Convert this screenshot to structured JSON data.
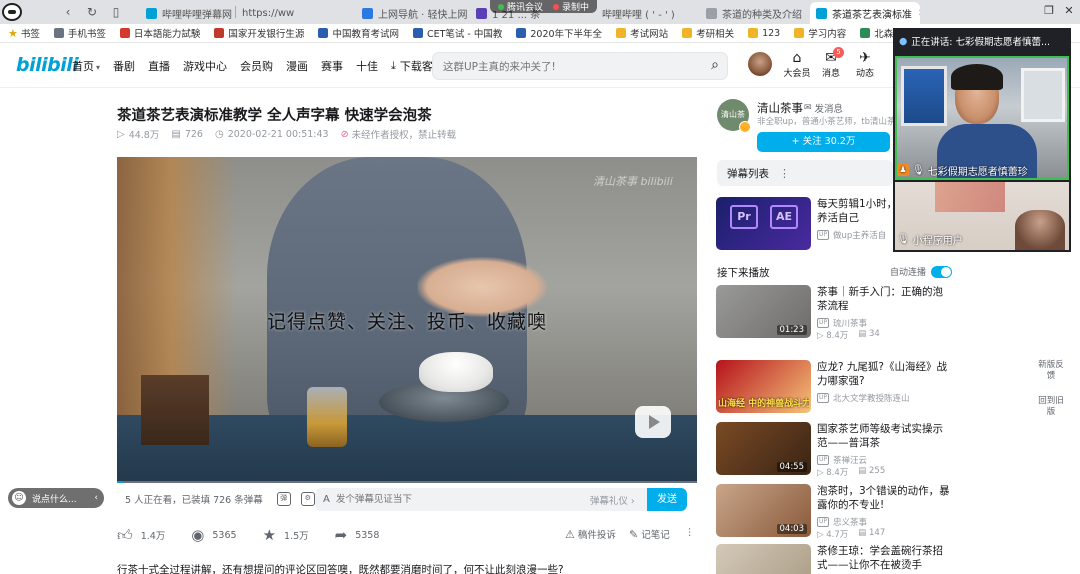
{
  "browser": {
    "tabs": [
      {
        "label": "哔哩哔哩弹幕网",
        "active": false
      },
      {
        "label": "https://ww",
        "active": false
      },
      {
        "label": "上网导航 · 轻快上网",
        "active": false
      },
      {
        "label": "1 21 ... 茶",
        "active": false
      },
      {
        "label": "哔哩哔哩 ( ' - ' )",
        "active": false
      },
      {
        "label": "茶道的种类及介绍",
        "active": false
      },
      {
        "label": "茶道茶艺表演标准",
        "active": true
      }
    ],
    "meeting_status": {
      "app": "腾讯会议",
      "recording": "录制中"
    },
    "window_controls": {
      "restore": "❐",
      "close": "✕"
    }
  },
  "bookmarks": [
    {
      "label": "书签",
      "color": "#e0a800"
    },
    {
      "label": "手机书签",
      "color": "#6b7380"
    },
    {
      "label": "日本語能力試験",
      "color": "#d43b2e"
    },
    {
      "label": "国家开发银行生源",
      "color": "#c0392b"
    },
    {
      "label": "中国教育考试网",
      "color": "#2a5fb0"
    },
    {
      "label": "CET笔试 - 中国教",
      "color": "#2a5fb0"
    },
    {
      "label": "2020年下半年全",
      "color": "#2a5fb0"
    },
    {
      "label": "考试网站",
      "color": "#f0b429"
    },
    {
      "label": "考研相关",
      "color": "#f0b429"
    },
    {
      "label": "123",
      "color": "#f0b429"
    },
    {
      "label": "学习内容",
      "color": "#f0b429"
    },
    {
      "label": "北森生涯教育一",
      "color": "#2e8b57"
    }
  ],
  "header": {
    "logo": "bilibili",
    "nav": [
      {
        "label": "首页",
        "chevron": true
      },
      {
        "label": "番剧"
      },
      {
        "label": "直播"
      },
      {
        "label": "游戏中心"
      },
      {
        "label": "会员购"
      },
      {
        "label": "漫画"
      },
      {
        "label": "赛事"
      },
      {
        "label": "十佳"
      }
    ],
    "download_client": "下载客户端",
    "search_placeholder": "这群UP主真的来冲关了!",
    "user_actions": [
      {
        "label": "大会员",
        "icon": "vip-icon",
        "badge": ""
      },
      {
        "label": "消息",
        "icon": "message-icon",
        "badge": "5"
      },
      {
        "label": "动态",
        "icon": "dynamic-icon",
        "badge": ""
      }
    ]
  },
  "video": {
    "title": "茶道茶艺表演标准教学 全人声字幕 快速学会泡茶",
    "views": "44.8万",
    "danmaku_count": "726",
    "publish_time": "2020-02-21 00:51:43",
    "copyright_notice": "未经作者授权，禁止转载",
    "subtitle": "记得点赞、关注、投币、收藏噢",
    "watermark": "清山茶事 bilibili",
    "progress_fraction": 0.01
  },
  "danmaku_bar": {
    "viewers": "5 人正在看，已装填 726 条弹幕",
    "placeholder": "发个弹幕见证当下",
    "etiquette": "弹幕礼仪 ›",
    "send": "发送"
  },
  "actions": {
    "like": "1.4万",
    "coin": "5365",
    "favorite": "1.5万",
    "share": "5358",
    "report": "稿件投诉",
    "notes": "记笔记"
  },
  "description_line": "行茶十式全过程讲解，还有想提问的评论区回答噢，既然都要消磨时间了，何不让此刻浪漫一些?",
  "chat_pill": {
    "label": "说点什么..."
  },
  "uploader": {
    "avatar_text": "清山茶",
    "name": "清山茶事",
    "message": "发消息",
    "desc": "非全职up，普通小茶艺师，tb清山茶事",
    "follow": "+ 关注 30.2万"
  },
  "danmaku_list": {
    "label": "弹幕列表"
  },
  "next_up": {
    "label": "接下来播放",
    "autoplay": "自动连播",
    "autoplay_on": true
  },
  "recommendations": [
    {
      "title": "每天剪辑1小时，让你的孩子养活自己",
      "author": "做up主养活自",
      "duration": "",
      "views": "",
      "danmaku": "",
      "thumb_text": "",
      "colors": [
        "#1a1f6b",
        "#4a2aa0"
      ]
    },
    {
      "title": "茶事｜新手入门：正确的泡茶流程",
      "author": "琉川茶事",
      "duration": "01:23",
      "views": "8.4万",
      "danmaku": "34",
      "thumb_text": "",
      "colors": [
        "#9a9a98",
        "#6d6c6a"
      ]
    },
    {
      "title": "应龙? 九尾狐?《山海经》战力哪家强?",
      "author": "北大文学教授陈连山",
      "duration": "",
      "views": "",
      "danmaku": "",
      "thumb_text": "山海经 中的神兽战斗力",
      "colors": [
        "#b5121b",
        "#f5c37a"
      ]
    },
    {
      "title": "国家茶艺师等级考试实操示范——普洱茶",
      "author": "茶禅汪云",
      "duration": "04:55",
      "views": "8.4万",
      "danmaku": "255",
      "thumb_text": "",
      "colors": [
        "#7a4a25",
        "#3a2414"
      ]
    },
    {
      "title": "泡茶时，3个错误的动作，暴露你的不专业!",
      "author": "忠义茶事",
      "duration": "04:03",
      "views": "4.7万",
      "danmaku": "147",
      "thumb_text": "",
      "colors": [
        "#c8a58a",
        "#8a5a3a"
      ]
    },
    {
      "title": "茶修王琼：学会盖碗行茶招式——让你不在被烫手",
      "author": "",
      "duration": "",
      "views": "",
      "danmaku": "",
      "thumb_text": "",
      "colors": [
        "#d4c9b8",
        "#a89a84"
      ]
    }
  ],
  "side_buttons": [
    {
      "label": "新版反馈"
    },
    {
      "label": "回到旧版"
    }
  ],
  "meeting_panel": {
    "speaking_now": "正在讲话: 七彩假期志愿者慎蕾...",
    "participant_1": "七彩假期志愿者慎蕾珍",
    "participant_2": "小程序用户"
  }
}
